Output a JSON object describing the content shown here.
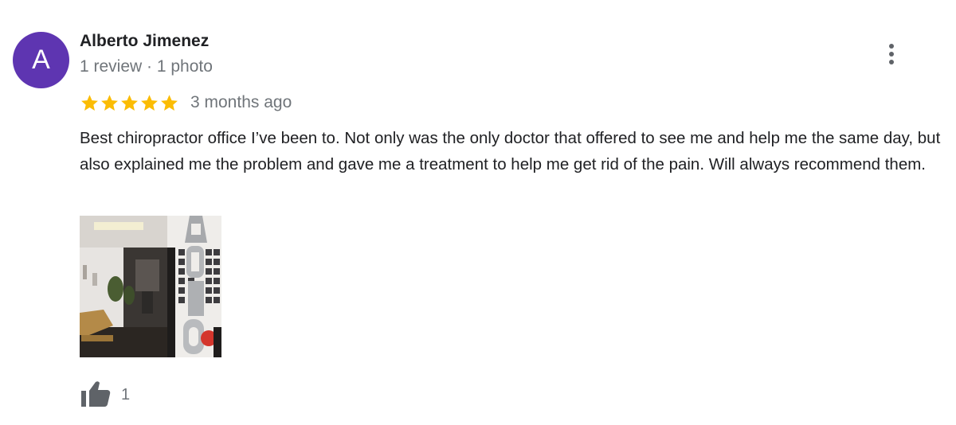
{
  "review": {
    "avatar_initial": "A",
    "avatar_color": "#5e35b1",
    "author_name": "Alberto Jimenez",
    "author_meta": "1 review · 1 photo",
    "rating": 5,
    "rating_max": 5,
    "star_color": "#fbbc04",
    "time": "3 months ago",
    "text": "Best chiropractor office I’ve been to. Not only was the only doctor that offered to see me and help me the same day, but also explained me the problem and gave me a treatment to help me get rid of the pain. Will always recommend them.",
    "photo_icon": "review-photo-thumbnail",
    "like_icon": "thumbs-up-icon",
    "like_count": "1",
    "menu_icon": "more-vert-icon"
  }
}
